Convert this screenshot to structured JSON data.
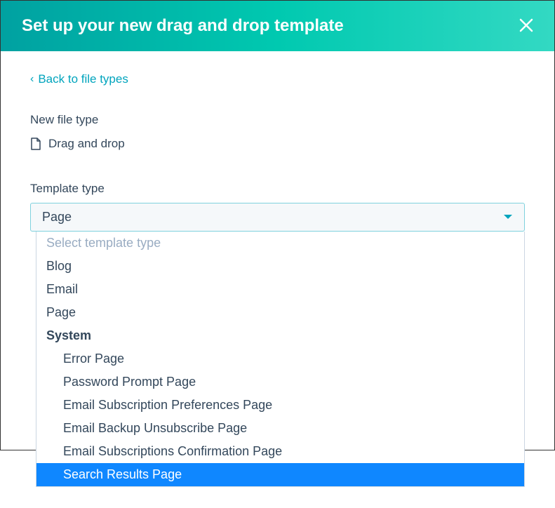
{
  "header": {
    "title": "Set up your new drag and drop template"
  },
  "back_link": {
    "caret": "‹",
    "label": "Back to file types"
  },
  "file_type": {
    "label": "New file type",
    "value": "Drag and drop"
  },
  "template_type": {
    "label": "Template type",
    "selected": "Page",
    "options": [
      {
        "label": "Select template type",
        "placeholder": true,
        "bold": false,
        "sub": false,
        "highlighted": false
      },
      {
        "label": "Blog",
        "placeholder": false,
        "bold": false,
        "sub": false,
        "highlighted": false
      },
      {
        "label": "Email",
        "placeholder": false,
        "bold": false,
        "sub": false,
        "highlighted": false
      },
      {
        "label": "Page",
        "placeholder": false,
        "bold": false,
        "sub": false,
        "highlighted": false
      },
      {
        "label": "System",
        "placeholder": false,
        "bold": true,
        "sub": false,
        "highlighted": false
      },
      {
        "label": "Error Page",
        "placeholder": false,
        "bold": false,
        "sub": true,
        "highlighted": false
      },
      {
        "label": "Password Prompt Page",
        "placeholder": false,
        "bold": false,
        "sub": true,
        "highlighted": false
      },
      {
        "label": "Email Subscription Preferences Page",
        "placeholder": false,
        "bold": false,
        "sub": true,
        "highlighted": false
      },
      {
        "label": "Email Backup Unsubscribe Page",
        "placeholder": false,
        "bold": false,
        "sub": true,
        "highlighted": false
      },
      {
        "label": "Email Subscriptions Confirmation Page",
        "placeholder": false,
        "bold": false,
        "sub": true,
        "highlighted": false
      },
      {
        "label": "Search Results Page",
        "placeholder": false,
        "bold": false,
        "sub": true,
        "highlighted": true
      }
    ]
  }
}
